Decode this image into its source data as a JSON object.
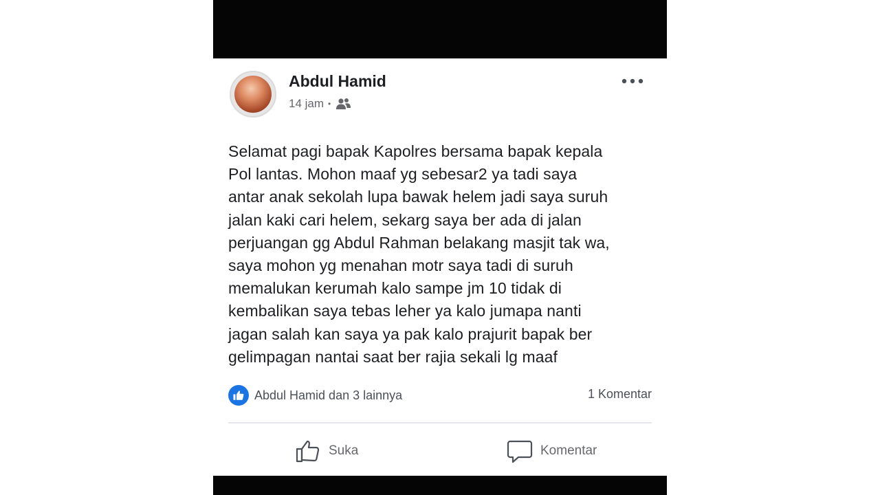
{
  "post": {
    "author": "Abdul Hamid",
    "time": "14 jam",
    "separator": "•",
    "audience_icon": "friends-icon",
    "menu_icon": "more-options-icon",
    "text": "Selamat pagi bapak Kapolres bersama bapak kepala\nPol lantas. Mohon maaf yg sebesar2 ya tadi saya\nantar anak sekolah lupa bawak helem jadi saya suruh\njalan kaki cari helem, sekarg saya ber ada di jalan\nperjuangan gg Abdul Rahman belakang masjit tak wa,\nsaya mohon yg menahan motr saya tadi di suruh\nmemalukan kerumah kalo sampe jm 10 tidak di\nkembalikan saya tebas leher ya kalo jumapa nanti\njagan salah kan saya ya pak kalo prajurit bapak ber\ngelimpagan nantai saat ber rajia sekali lg maaf"
  },
  "reactions": {
    "summary": "Abdul Hamid dan 3 lainnya",
    "icon": "like-reaction-icon",
    "comments": "1 Komentar"
  },
  "actions": {
    "like_label": "Suka",
    "comment_label": "Komentar"
  },
  "colors": {
    "accent": "#1b74e4",
    "text": "#1c1e21",
    "muted": "#65676b",
    "bars": "#050505"
  }
}
